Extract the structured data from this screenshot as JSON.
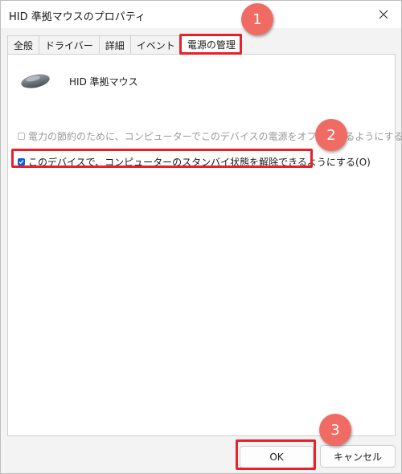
{
  "window": {
    "title": "HID 準拠マウスのプロパティ"
  },
  "tabs": [
    {
      "label": "全般"
    },
    {
      "label": "ドライバー"
    },
    {
      "label": "詳細"
    },
    {
      "label": "イベント"
    },
    {
      "label": "電源の管理"
    }
  ],
  "device": {
    "name": "HID 準拠マウス"
  },
  "options": [
    {
      "label": "電力の節約のために、コンピューターでこのデバイスの電源をオフにできるようにする(A)",
      "checked": false,
      "disabled": true
    },
    {
      "label": "このデバイスで、コンピューターのスタンバイ状態を解除できるようにする(O)",
      "checked": true,
      "disabled": false
    }
  ],
  "buttons": {
    "ok": "OK",
    "cancel": "キャンセル"
  },
  "annotations": {
    "badge1": "1",
    "badge2": "2",
    "badge3": "3"
  },
  "colors": {
    "highlight": "#e8202a",
    "badge": "#f06b63",
    "checkbox": "#0b5cd5"
  }
}
